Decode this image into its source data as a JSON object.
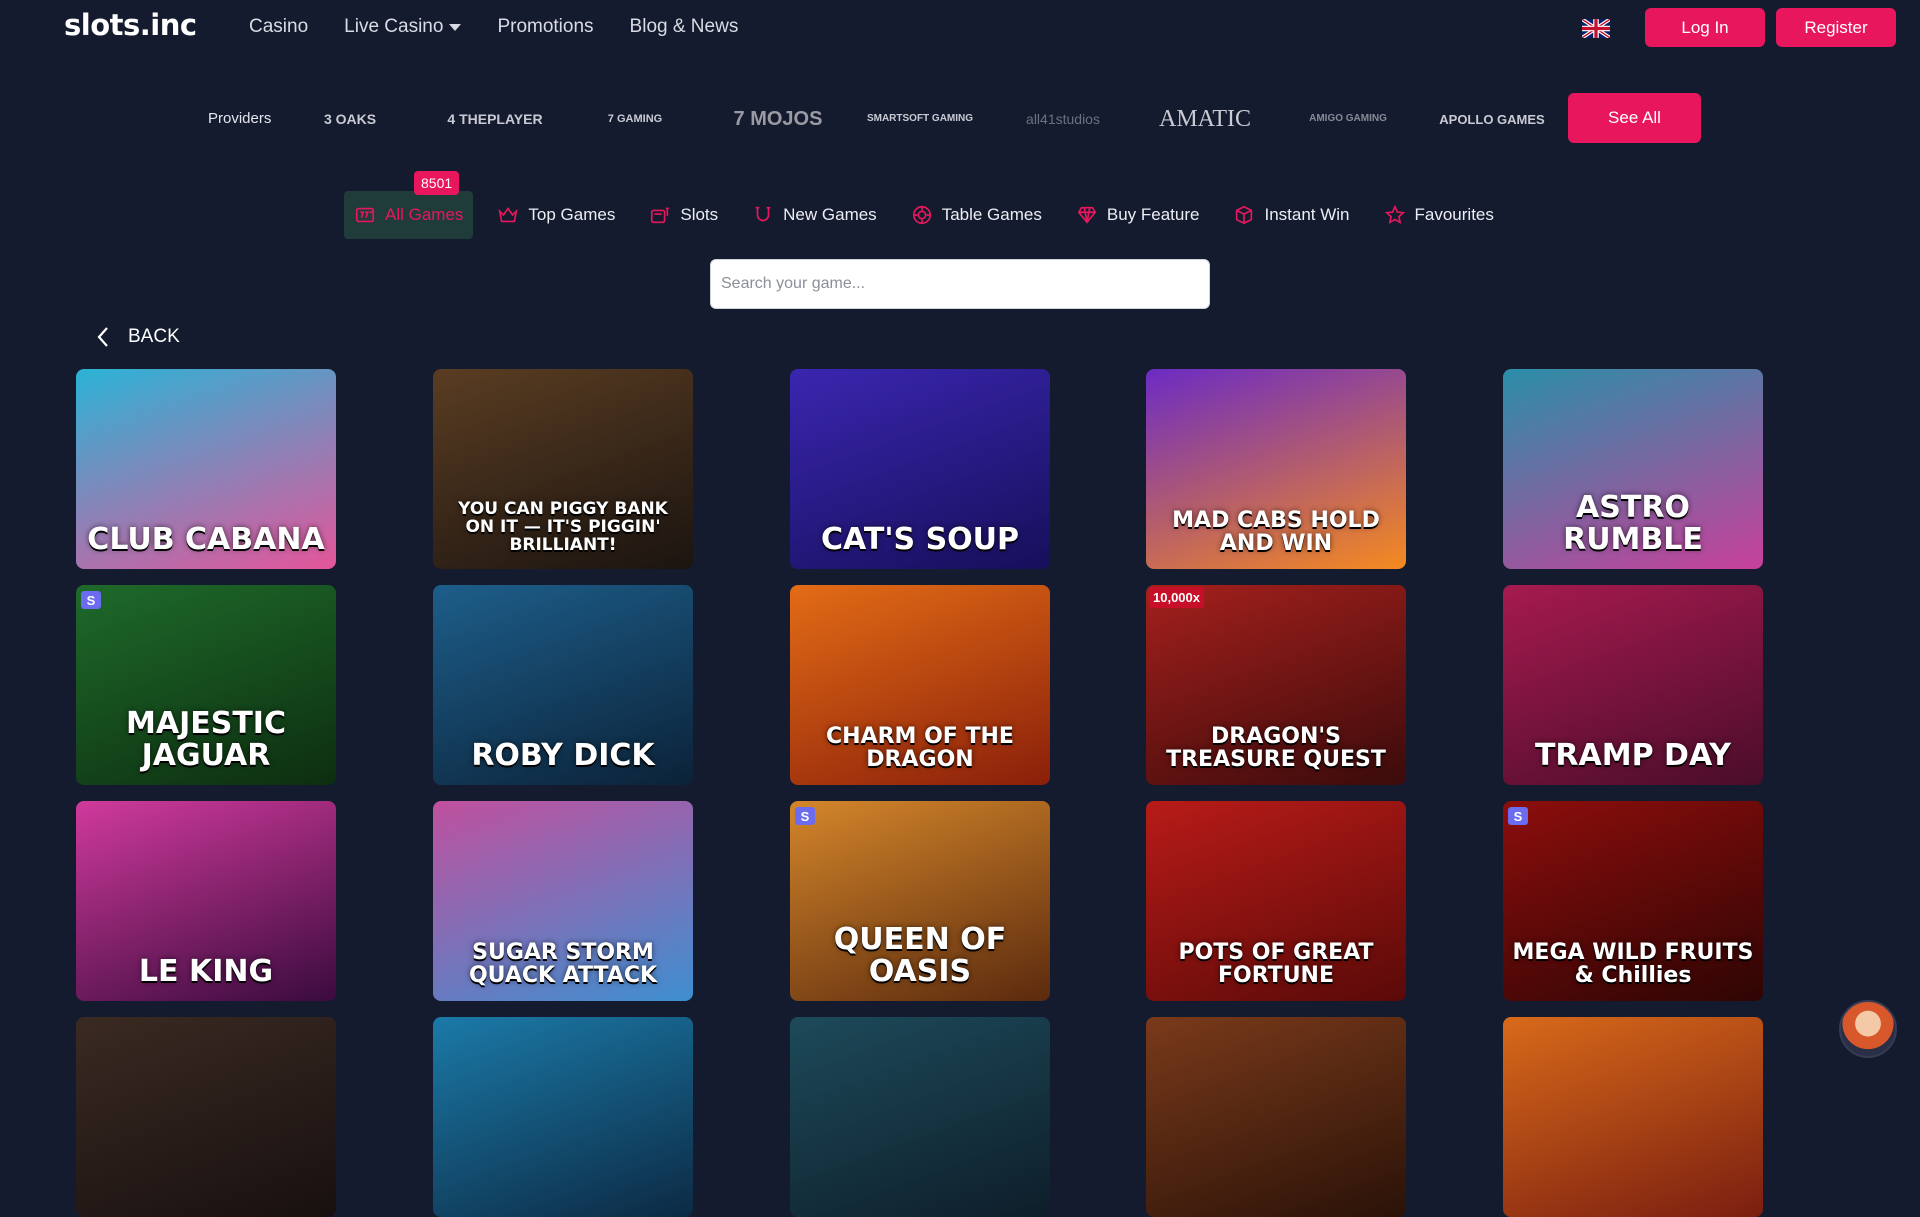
{
  "header": {
    "logo": "slots.inc",
    "nav": [
      {
        "label": "Casino"
      },
      {
        "label": "Live Casino"
      },
      {
        "label": "Promotions"
      },
      {
        "label": "Blog & News"
      }
    ],
    "login_label": "Log In",
    "register_label": "Register"
  },
  "providers": {
    "label": "Providers",
    "items": [
      {
        "name": "3 OAKS"
      },
      {
        "name": "4 THEPLAYER"
      },
      {
        "name": "7 GAMING"
      },
      {
        "name": "7 MOJOS"
      },
      {
        "name": "SMARTSOFT GAMING"
      },
      {
        "name": "all41studios"
      },
      {
        "name": "AMATIC"
      },
      {
        "name": "AMIGO GAMING"
      },
      {
        "name": "APOLLO GAMES"
      }
    ],
    "see_all_label": "See All"
  },
  "categories": {
    "count_badge": "8501",
    "items": [
      {
        "label": "All Games",
        "icon": "all-games-icon"
      },
      {
        "label": "Top Games",
        "icon": "crown-icon"
      },
      {
        "label": "Slots",
        "icon": "slot-machine-icon"
      },
      {
        "label": "New Games",
        "icon": "horseshoe-icon"
      },
      {
        "label": "Table Games",
        "icon": "chip-icon"
      },
      {
        "label": "Buy Feature",
        "icon": "gem-icon"
      },
      {
        "label": "Instant Win",
        "icon": "dice-icon"
      },
      {
        "label": "Favourites",
        "icon": "star-icon"
      }
    ]
  },
  "search": {
    "placeholder": "Search your game..."
  },
  "back_label": "BACK",
  "games": [
    {
      "title": "CLUB CABANA",
      "bg1": "#2bb3d6",
      "bg2": "#e5559a"
    },
    {
      "title": "YOU CAN PIGGY BANK ON IT — IT'S PIGGIN' BRILLIANT!",
      "bg1": "#5a3d22",
      "bg2": "#1b1410"
    },
    {
      "title": "CAT'S SOUP",
      "bg1": "#3a26b0",
      "bg2": "#160f5a"
    },
    {
      "title": "MAD CABS HOLD AND WIN",
      "bg1": "#6b2bc4",
      "bg2": "#f58a1f"
    },
    {
      "title": "ASTRO RUMBLE",
      "bg1": "#2a8ea8",
      "bg2": "#c8409a"
    },
    {
      "title": "MAJESTIC JAGUAR",
      "bg1": "#1e6a2a",
      "bg2": "#0d2e10",
      "badge_s": "S"
    },
    {
      "title": "ROBY DICK",
      "bg1": "#1d5e8a",
      "bg2": "#0b2238"
    },
    {
      "title": "CHARM OF THE DRAGON",
      "bg1": "#e36c16",
      "bg2": "#8a1f0a"
    },
    {
      "title": "DRAGON'S TREASURE QUEST",
      "bg1": "#a4201c",
      "bg2": "#3b0b0b",
      "badge": "10,000x"
    },
    {
      "title": "TRAMP DAY",
      "bg1": "#a61a4f",
      "bg2": "#4a0d2a"
    },
    {
      "title": "LE KING",
      "bg1": "#d03a9c",
      "bg2": "#3a0b3d"
    },
    {
      "title": "SUGAR STORM QUACK ATTACK",
      "bg1": "#c0509e",
      "bg2": "#3e8fd0"
    },
    {
      "title": "QUEEN OF OASIS",
      "bg1": "#d4862a",
      "bg2": "#5b2a0e",
      "badge_s": "S"
    },
    {
      "title": "POTS OF GREAT FORTUNE",
      "bg1": "#b81b18",
      "bg2": "#5a0a08"
    },
    {
      "title": "MEGA WILD FRUITS & Chillies",
      "bg1": "#8c0e0c",
      "bg2": "#2e0504",
      "badge_s": "S"
    },
    {
      "title": "",
      "bg1": "#3a2a22",
      "bg2": "#181010"
    },
    {
      "title": "",
      "bg1": "#1b7aa8",
      "bg2": "#0c2a44"
    },
    {
      "title": "",
      "bg1": "#1d4a5a",
      "bg2": "#0e1e2a"
    },
    {
      "title": "",
      "bg1": "#7a3a1a",
      "bg2": "#2a1208"
    },
    {
      "title": "",
      "bg1": "#d86a1a",
      "bg2": "#7a1e10"
    }
  ],
  "colors": {
    "accent": "#e8175d",
    "background": "#151b2e",
    "active_tab": "#1f3b3a"
  }
}
